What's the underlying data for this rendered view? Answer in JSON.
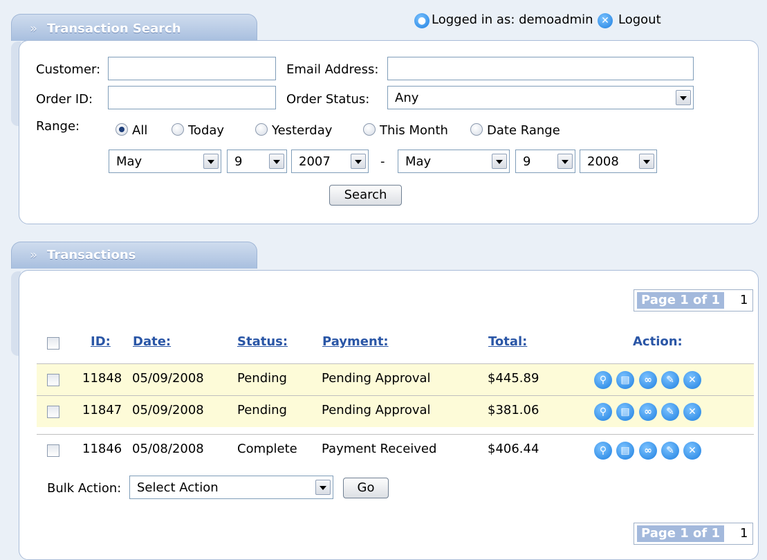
{
  "header": {
    "logged_in_text": "Logged in as: demoadmin",
    "logout_label": "Logout"
  },
  "search_panel": {
    "tab_title": "Transaction Search",
    "customer_label": "Customer:",
    "customer_value": "",
    "email_label": "Email Address:",
    "email_value": "",
    "order_id_label": "Order ID:",
    "order_id_value": "",
    "order_status_label": "Order Status:",
    "order_status_value": "Any",
    "range_label": "Range:",
    "range_options": [
      "All",
      "Today",
      "Yesterday",
      "This Month",
      "Date Range"
    ],
    "range_selected": "All",
    "from_month": "May",
    "from_day": "9",
    "from_year": "2007",
    "range_dash": "-",
    "to_month": "May",
    "to_day": "9",
    "to_year": "2008",
    "search_button": "Search"
  },
  "transactions_panel": {
    "tab_title": "Transactions",
    "pager_label": "Page 1 of 1",
    "pager_number": "1",
    "columns": {
      "id": "ID:",
      "date": "Date:",
      "status": "Status:",
      "payment": "Payment:",
      "total": "Total:",
      "action": "Action:"
    },
    "rows": [
      {
        "id": "11848",
        "date": "05/09/2008",
        "status": "Pending",
        "payment": "Pending Approval",
        "total": "$445.89"
      },
      {
        "id": "11847",
        "date": "05/09/2008",
        "status": "Pending",
        "payment": "Pending Approval",
        "total": "$381.06"
      },
      {
        "id": "11846",
        "date": "05/08/2008",
        "status": "Complete",
        "payment": "Payment Received",
        "total": "$406.44"
      }
    ],
    "action_icons": [
      "view-icon",
      "print-icon",
      "attach-icon",
      "edit-icon",
      "delete-icon"
    ],
    "bulk_action_label": "Bulk Action:",
    "bulk_action_value": "Select Action",
    "go_button": "Go"
  },
  "colors": {
    "link_blue": "#2a56a6",
    "pending_row": "#fdfbd8",
    "action_icon": "#1e7fe0"
  }
}
